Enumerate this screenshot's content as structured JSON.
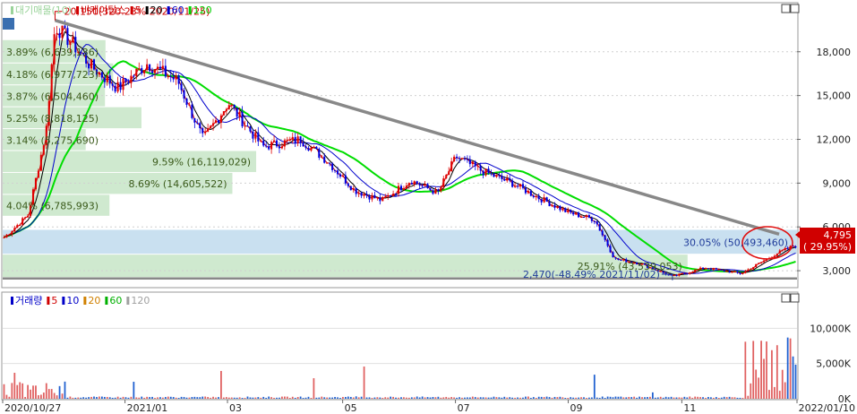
{
  "price_panel": {
    "legend": [
      {
        "label": "대기매물(10)",
        "color": "#9ad39a"
      },
      {
        "label": "비케이탑스",
        "color": "#d00000"
      },
      {
        "label": "5",
        "color": "#d00000"
      },
      {
        "label": "20",
        "color": "#000000"
      },
      {
        "label": "60",
        "color": "#0000c8"
      },
      {
        "label": "120",
        "color": "#00d000"
      }
    ],
    "y_ticks": [
      "18,000",
      "15,000",
      "12,000",
      "9,000",
      "6,000",
      "3,000"
    ],
    "y_tick_values": [
      18000,
      15000,
      12000,
      9000,
      6000,
      3000
    ],
    "ylim": [
      1900,
      21300
    ],
    "high_label": "20,150(320.23% 2020/11/25)",
    "low_label": "2,470(-48.49% 2021/11/02)",
    "current_price": {
      "value": "4,795",
      "change": "( 29.95%)",
      "color": "#d00000"
    },
    "supply_zones": [
      {
        "label": "3.89% (6,639,136)",
        "pct": 3.89,
        "volume": 6639136,
        "range": [
          17200,
          18800
        ]
      },
      {
        "label": "4.18% (6,977,723)",
        "pct": 4.18,
        "volume": 6977723,
        "range": [
          15700,
          17200
        ]
      },
      {
        "label": "3.87% (6,504,460)",
        "pct": 3.87,
        "volume": 6504460,
        "range": [
          14200,
          15700
        ]
      },
      {
        "label": "5.25% (8,818,125)",
        "pct": 5.25,
        "volume": 8818125,
        "range": [
          12700,
          14200
        ]
      },
      {
        "label": "3.14% (5,275,690)",
        "pct": 3.14,
        "volume": 5275690,
        "range": [
          11200,
          12700
        ]
      },
      {
        "label": "9.59% (16,119,029)",
        "pct": 9.59,
        "volume": 16119029,
        "range": [
          9700,
          11200
        ]
      },
      {
        "label": "8.69% (14,605,522)",
        "pct": 8.69,
        "volume": 14605522,
        "range": [
          8200,
          9700
        ]
      },
      {
        "label": "4.04% (6,785,993)",
        "pct": 4.04,
        "volume": 6785993,
        "range": [
          6700,
          8200
        ]
      },
      {
        "label": "30.05% (50,493,460)",
        "pct": 30.05,
        "volume": 50493460,
        "range": [
          4100,
          5800
        ],
        "highlight": true
      },
      {
        "label": "25.91% (43,539,053)",
        "pct": 25.91,
        "volume": 43539053,
        "range": [
          2500,
          4100
        ]
      }
    ]
  },
  "volume_panel": {
    "legend": [
      {
        "label": "거래량",
        "color": "#0000c8"
      },
      {
        "label": "5",
        "color": "#d00000"
      },
      {
        "label": "10",
        "color": "#0000c8"
      },
      {
        "label": "20",
        "color": "#d08000"
      },
      {
        "label": "60",
        "color": "#00b000"
      },
      {
        "label": "120",
        "color": "#a0a0a0"
      }
    ],
    "y_ticks": [
      "10,000K",
      "5,000K",
      "0K"
    ],
    "y_tick_values": [
      10000,
      5000,
      0
    ],
    "ylim": [
      0,
      15000
    ]
  },
  "x_ticks": [
    {
      "label": "2020/10/27",
      "frac": 0.0
    },
    {
      "label": "2021/01",
      "frac": 0.154
    },
    {
      "label": "03",
      "frac": 0.283
    },
    {
      "label": "05",
      "frac": 0.428
    },
    {
      "label": "07",
      "frac": 0.57
    },
    {
      "label": "09",
      "frac": 0.712
    },
    {
      "label": "11",
      "frac": 0.855
    },
    {
      "label": "2022/01/10",
      "frac": 1.0
    }
  ],
  "chart_data": {
    "type": "candlestick",
    "title": "비케이탑스",
    "x_range": [
      "2020/10/27",
      "2022/01/10"
    ],
    "ylim": [
      1900,
      21300
    ],
    "close_series": [
      {
        "x": "2020/10/27",
        "y": 5200
      },
      {
        "x": "2020/11/10",
        "y": 6800
      },
      {
        "x": "2020/11/20",
        "y": 12500
      },
      {
        "x": "2020/11/25",
        "y": 19800
      },
      {
        "x": "2020/12/05",
        "y": 18500
      },
      {
        "x": "2020/12/15",
        "y": 17000
      },
      {
        "x": "2020/12/30",
        "y": 15500
      },
      {
        "x": "2021/01/15",
        "y": 17200
      },
      {
        "x": "2021/02/01",
        "y": 16000
      },
      {
        "x": "2021/02/15",
        "y": 12000
      },
      {
        "x": "2021/03/01",
        "y": 14500
      },
      {
        "x": "2021/03/20",
        "y": 11500
      },
      {
        "x": "2021/04/10",
        "y": 12000
      },
      {
        "x": "2021/04/25",
        "y": 10500
      },
      {
        "x": "2021/05/10",
        "y": 8500
      },
      {
        "x": "2021/05/25",
        "y": 7800
      },
      {
        "x": "2021/06/10",
        "y": 9200
      },
      {
        "x": "2021/06/25",
        "y": 8300
      },
      {
        "x": "2021/07/05",
        "y": 10800
      },
      {
        "x": "2021/07/20",
        "y": 9800
      },
      {
        "x": "2021/08/05",
        "y": 9000
      },
      {
        "x": "2021/08/20",
        "y": 8000
      },
      {
        "x": "2021/09/05",
        "y": 7000
      },
      {
        "x": "2021/09/20",
        "y": 6500
      },
      {
        "x": "2021/10/01",
        "y": 3800
      },
      {
        "x": "2021/10/15",
        "y": 3500
      },
      {
        "x": "2021/11/02",
        "y": 2600
      },
      {
        "x": "2021/11/20",
        "y": 3200
      },
      {
        "x": "2021/12/10",
        "y": 2800
      },
      {
        "x": "2021/12/30",
        "y": 4200
      },
      {
        "x": "2022/01/10",
        "y": 4795
      }
    ]
  }
}
